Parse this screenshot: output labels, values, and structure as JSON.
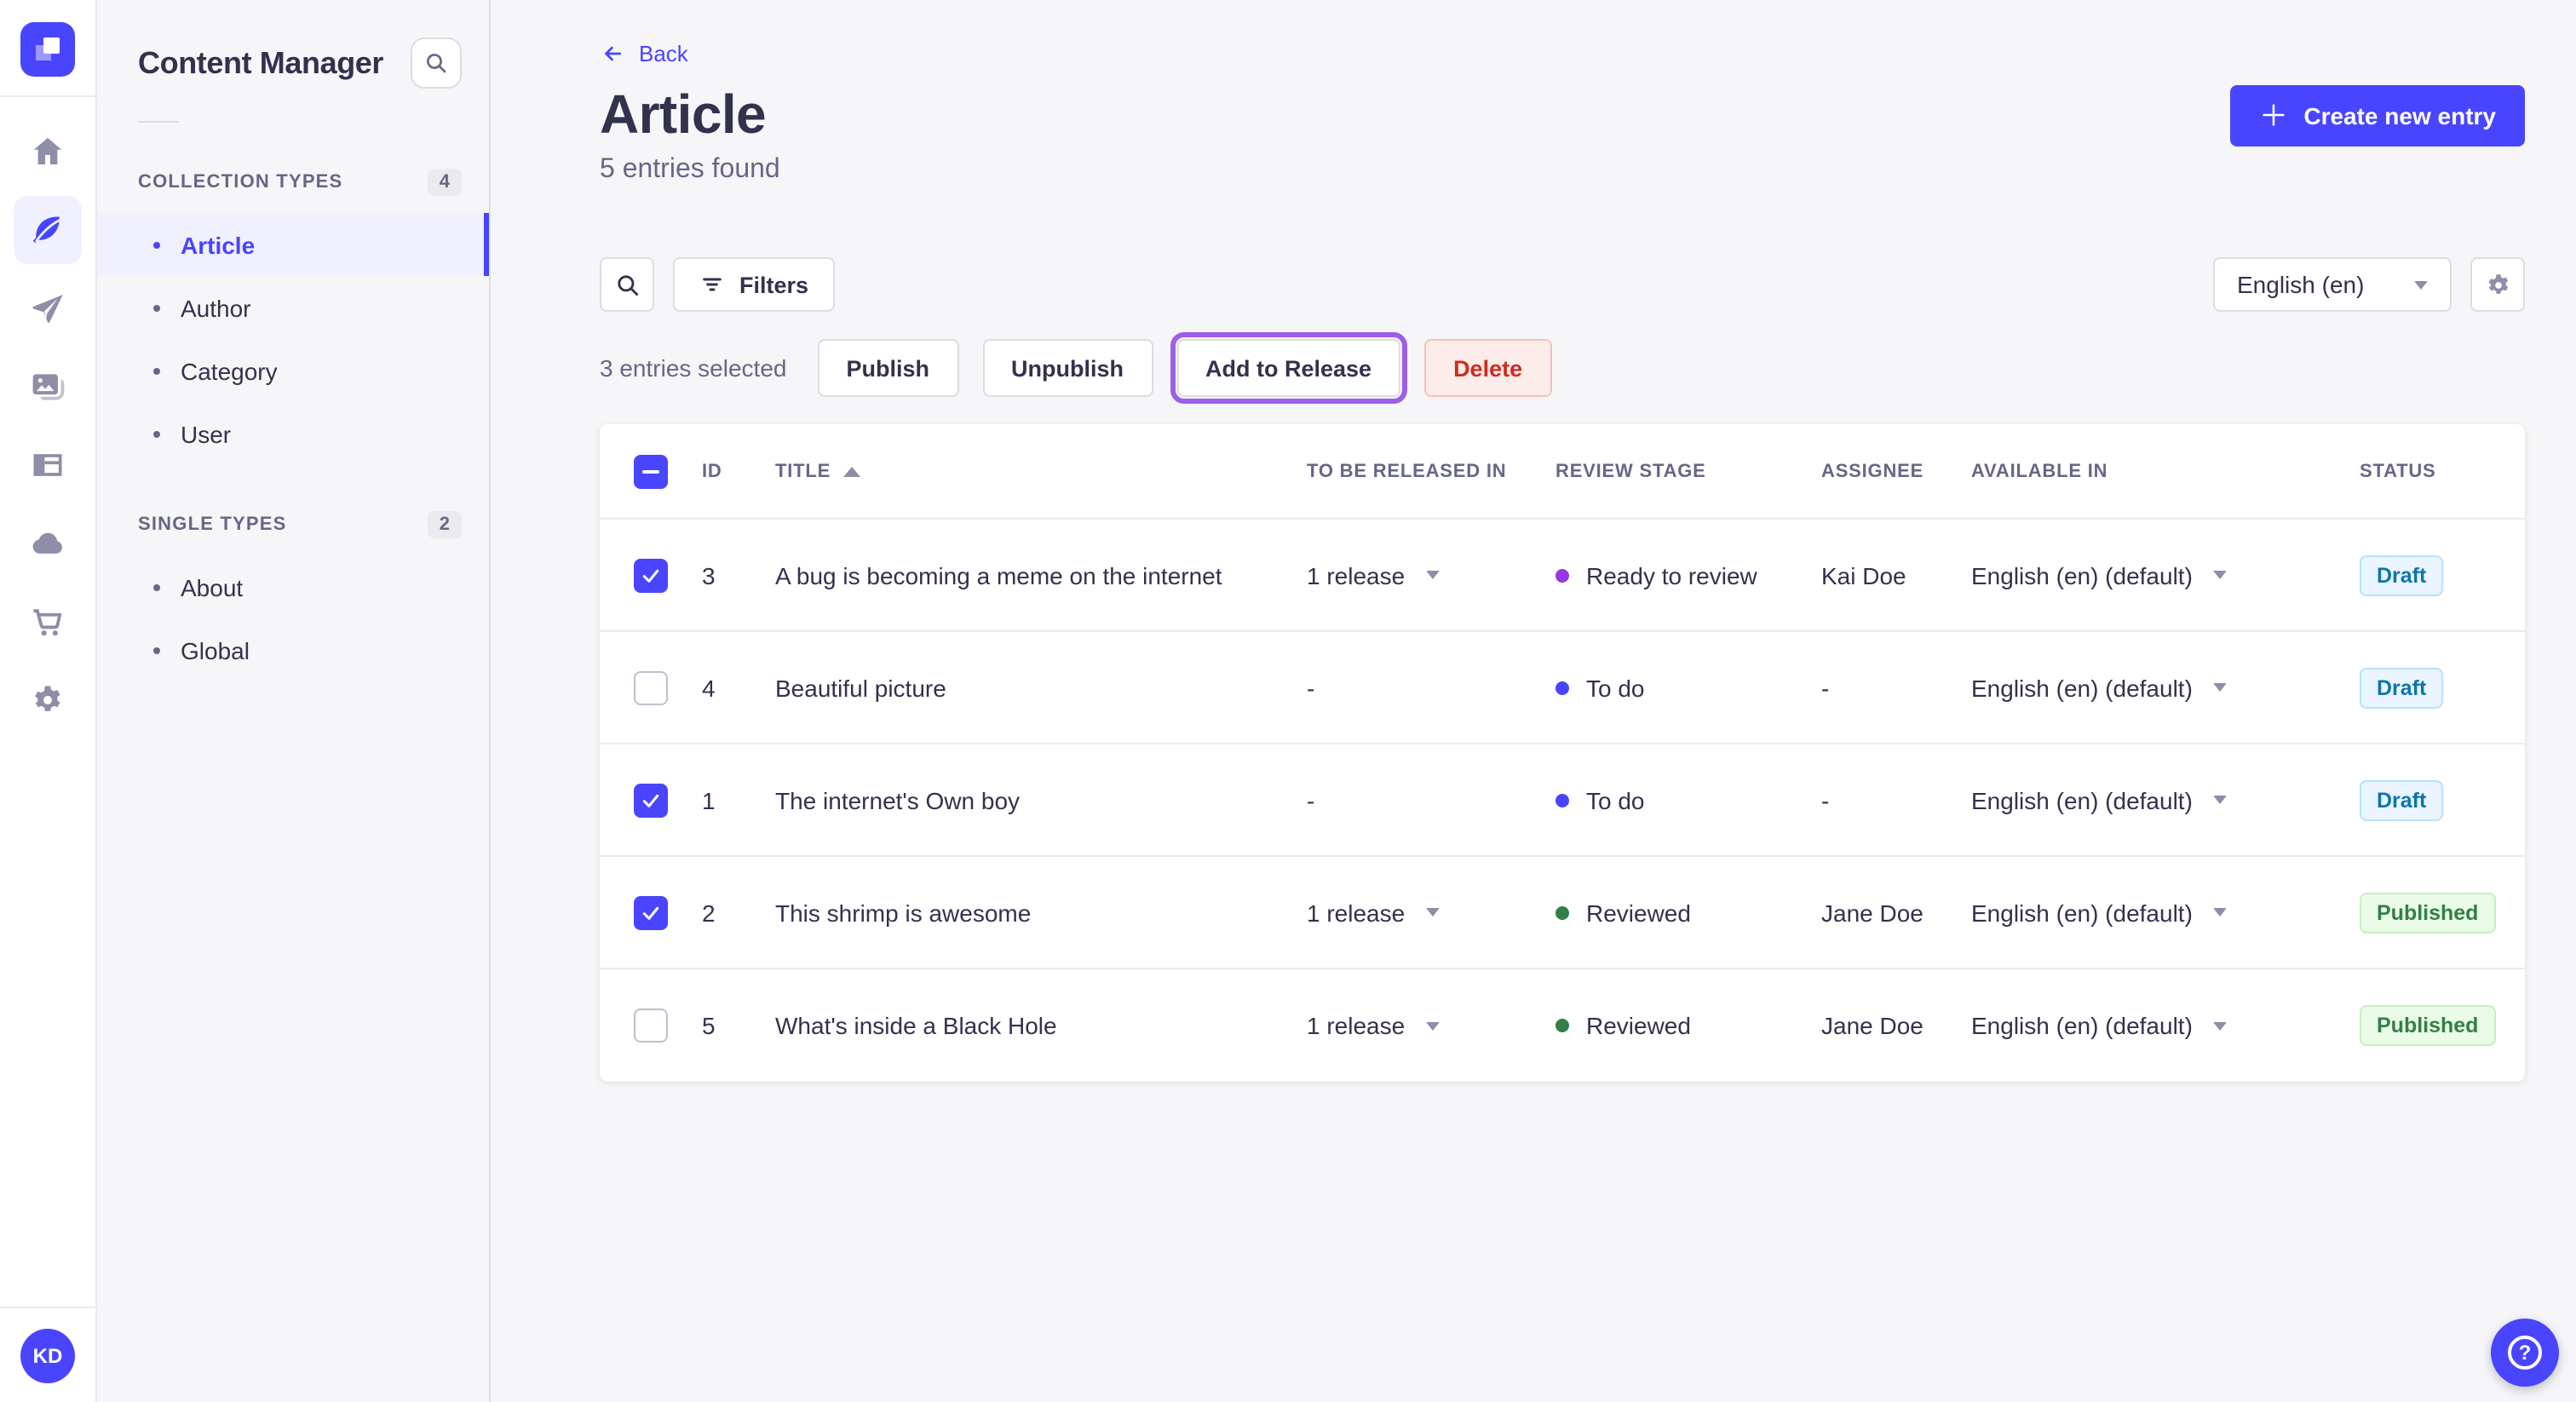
{
  "colors": {
    "primary": "#4945ff",
    "primary_light_bg": "#f0f0ff",
    "draft_text": "#0c75af",
    "published_text": "#328048",
    "danger_text": "#d02b20",
    "release_highlight_outline": "#9b5fe8",
    "review_ready": "#9736e8",
    "review_todo": "#4945ff",
    "review_reviewed": "#328048"
  },
  "rail": {
    "logo": "strapi-logo",
    "items": [
      {
        "name": "home",
        "icon": "home-icon",
        "active": false
      },
      {
        "name": "content-manager",
        "icon": "feather-icon",
        "active": true
      },
      {
        "name": "releases",
        "icon": "paper-plane-icon",
        "active": false
      },
      {
        "name": "media-library",
        "icon": "images-icon",
        "active": false
      },
      {
        "name": "content-type-builder",
        "icon": "layout-icon",
        "active": false
      },
      {
        "name": "cloud",
        "icon": "cloud-icon",
        "active": false
      },
      {
        "name": "marketplace",
        "icon": "cart-icon",
        "active": false
      },
      {
        "name": "settings",
        "icon": "gear-icon",
        "active": false
      }
    ],
    "avatar_initials": "KD"
  },
  "sidebar": {
    "title": "Content Manager",
    "search_icon": "search-icon",
    "sections": [
      {
        "label": "COLLECTION TYPES",
        "count": "4",
        "items": [
          {
            "label": "Article",
            "active": true
          },
          {
            "label": "Author",
            "active": false
          },
          {
            "label": "Category",
            "active": false
          },
          {
            "label": "User",
            "active": false
          }
        ]
      },
      {
        "label": "SINGLE TYPES",
        "count": "2",
        "items": [
          {
            "label": "About",
            "active": false
          },
          {
            "label": "Global",
            "active": false
          }
        ]
      }
    ]
  },
  "header": {
    "back_label": "Back",
    "title": "Article",
    "subtitle": "5 entries found",
    "create_button_label": "Create new entry"
  },
  "toolbar": {
    "filters_label": "Filters",
    "locale_selected": "English (en)"
  },
  "selection": {
    "summary": "3 entries selected",
    "publish_label": "Publish",
    "unpublish_label": "Unpublish",
    "add_to_release_label": "Add to Release",
    "delete_label": "Delete"
  },
  "table": {
    "header_checkbox_state": "indeterminate",
    "columns": [
      "ID",
      "TITLE",
      "TO BE RELEASED IN",
      "REVIEW STAGE",
      "ASSIGNEE",
      "AVAILABLE IN",
      "STATUS"
    ],
    "sorted_column": "TITLE",
    "sort_direction": "ascending",
    "rows": [
      {
        "selected": true,
        "id": "3",
        "title": "A bug is becoming a meme on the internet",
        "release": "1 release",
        "release_has_dropdown": true,
        "review": "Ready to review",
        "review_variant": "purple",
        "assignee": "Kai Doe",
        "locale": "English (en) (default)",
        "status": "Draft",
        "status_variant": "draft"
      },
      {
        "selected": false,
        "id": "4",
        "title": "Beautiful picture",
        "release": "-",
        "release_has_dropdown": false,
        "review": "To do",
        "review_variant": "blue",
        "assignee": "-",
        "locale": "English (en) (default)",
        "status": "Draft",
        "status_variant": "draft"
      },
      {
        "selected": true,
        "id": "1",
        "title": "The internet's Own boy",
        "release": "-",
        "release_has_dropdown": false,
        "review": "To do",
        "review_variant": "blue",
        "assignee": "-",
        "locale": "English (en) (default)",
        "status": "Draft",
        "status_variant": "draft"
      },
      {
        "selected": true,
        "id": "2",
        "title": "This shrimp is awesome",
        "release": "1 release",
        "release_has_dropdown": true,
        "review": "Reviewed",
        "review_variant": "green",
        "assignee": "Jane Doe",
        "locale": "English (en) (default)",
        "status": "Published",
        "status_variant": "published"
      },
      {
        "selected": false,
        "id": "5",
        "title": "What's inside a Black Hole",
        "release": "1 release",
        "release_has_dropdown": true,
        "review": "Reviewed",
        "review_variant": "green",
        "assignee": "Jane Doe",
        "locale": "English (en) (default)",
        "status": "Published",
        "status_variant": "published"
      }
    ]
  },
  "fab": {
    "help": "?"
  }
}
